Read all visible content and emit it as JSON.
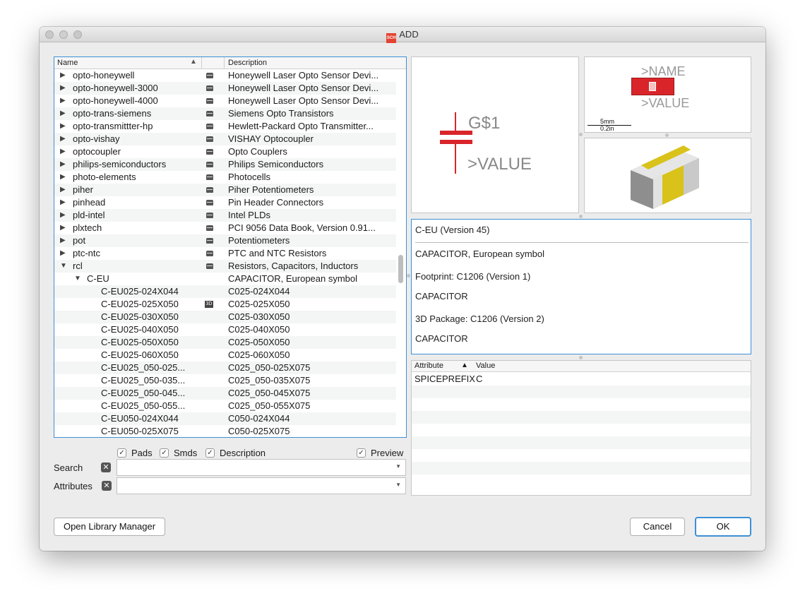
{
  "window": {
    "title": "ADD",
    "title_icon": "SCH"
  },
  "tree": {
    "columns": {
      "name": "Name",
      "description": "Description"
    },
    "rows": [
      {
        "name": "opto-honeywell",
        "desc": "Honeywell Laser Opto Sensor Devi...",
        "level": 0,
        "expanded": false,
        "icon": "lib"
      },
      {
        "name": "opto-honeywell-3000",
        "desc": "Honeywell Laser Opto Sensor Devi...",
        "level": 0,
        "expanded": false,
        "icon": "lib"
      },
      {
        "name": "opto-honeywell-4000",
        "desc": "Honeywell Laser Opto Sensor Devi...",
        "level": 0,
        "expanded": false,
        "icon": "lib"
      },
      {
        "name": "opto-trans-siemens",
        "desc": "Siemens Opto Transistors",
        "level": 0,
        "expanded": false,
        "icon": "lib"
      },
      {
        "name": "opto-transmittter-hp",
        "desc": "Hewlett-Packard Opto Transmitter...",
        "level": 0,
        "expanded": false,
        "icon": "lib"
      },
      {
        "name": "opto-vishay",
        "desc": "VISHAY Optocoupler",
        "level": 0,
        "expanded": false,
        "icon": "lib"
      },
      {
        "name": "optocoupler",
        "desc": "Opto Couplers",
        "level": 0,
        "expanded": false,
        "icon": "lib"
      },
      {
        "name": "philips-semiconductors",
        "desc": "Philips Semiconductors",
        "level": 0,
        "expanded": false,
        "icon": "lib"
      },
      {
        "name": "photo-elements",
        "desc": "Photocells",
        "level": 0,
        "expanded": false,
        "icon": "lib"
      },
      {
        "name": "piher",
        "desc": "Piher Potentiometers",
        "level": 0,
        "expanded": false,
        "icon": "lib"
      },
      {
        "name": "pinhead",
        "desc": "Pin Header Connectors",
        "level": 0,
        "expanded": false,
        "icon": "lib"
      },
      {
        "name": "pld-intel",
        "desc": "Intel PLDs",
        "level": 0,
        "expanded": false,
        "icon": "lib"
      },
      {
        "name": "plxtech",
        "desc": "PCI 9056 Data Book, Version 0.91...",
        "level": 0,
        "expanded": false,
        "icon": "lib"
      },
      {
        "name": "pot",
        "desc": "Potentiometers",
        "level": 0,
        "expanded": false,
        "icon": "lib"
      },
      {
        "name": "ptc-ntc",
        "desc": "PTC and NTC Resistors",
        "level": 0,
        "expanded": false,
        "icon": "lib"
      },
      {
        "name": "rcl",
        "desc": "Resistors, Capacitors, Inductors",
        "level": 0,
        "expanded": true,
        "icon": "lib"
      },
      {
        "name": "C-EU",
        "desc": "CAPACITOR, European symbol",
        "level": 1,
        "expanded": true,
        "icon": ""
      },
      {
        "name": "C-EU025-024X044",
        "desc": "C025-024X044",
        "level": 2,
        "icon": ""
      },
      {
        "name": "C-EU025-025X050",
        "desc": "C025-025X050",
        "level": 2,
        "icon": "3d"
      },
      {
        "name": "C-EU025-030X050",
        "desc": "C025-030X050",
        "level": 2,
        "icon": ""
      },
      {
        "name": "C-EU025-040X050",
        "desc": "C025-040X050",
        "level": 2,
        "icon": ""
      },
      {
        "name": "C-EU025-050X050",
        "desc": "C025-050X050",
        "level": 2,
        "icon": ""
      },
      {
        "name": "C-EU025-060X050",
        "desc": "C025-060X050",
        "level": 2,
        "icon": ""
      },
      {
        "name": "C-EU025_050-025...",
        "desc": "C025_050-025X075",
        "level": 2,
        "icon": ""
      },
      {
        "name": "C-EU025_050-035...",
        "desc": "C025_050-035X075",
        "level": 2,
        "icon": ""
      },
      {
        "name": "C-EU025_050-045...",
        "desc": "C025_050-045X075",
        "level": 2,
        "icon": ""
      },
      {
        "name": "C-EU025_050-055...",
        "desc": "C025_050-055X075",
        "level": 2,
        "icon": ""
      },
      {
        "name": "C-EU050-024X044",
        "desc": "C050-024X044",
        "level": 2,
        "icon": ""
      },
      {
        "name": "C-EU050-025X075",
        "desc": "C050-025X075",
        "level": 2,
        "icon": ""
      }
    ],
    "icon_3d_label": "3D"
  },
  "options": {
    "pads": "Pads",
    "smds": "Smds",
    "description": "Description",
    "preview": "Preview",
    "checked_mark": "✓"
  },
  "search": {
    "label": "Search",
    "value": ""
  },
  "attributes_filter": {
    "label": "Attributes",
    "value": ""
  },
  "symbol_preview": {
    "name": "G$1",
    "value": ">VALUE"
  },
  "package_preview": {
    "name": ">NAME",
    "value": ">VALUE",
    "scale_mm": "5mm",
    "scale_in": "0.2in"
  },
  "info": {
    "device": "C-EU (Version 45)",
    "device_desc": "CAPACITOR, European symbol",
    "footprint": "Footprint: C1206 (Version 1)",
    "footprint_desc": "CAPACITOR",
    "package3d": "3D Package: C1206 (Version 2)",
    "package3d_desc": "CAPACITOR"
  },
  "attributes": {
    "col_attribute": "Attribute",
    "col_value": "Value",
    "rows": [
      {
        "attribute": "SPICEPREFIX",
        "value": "C"
      }
    ]
  },
  "buttons": {
    "library_manager": "Open Library Manager",
    "cancel": "Cancel",
    "ok": "OK"
  },
  "colors": {
    "accent": "#3d8fd6",
    "symbol_red": "#d9252a",
    "chip_yellow": "#d9c21a"
  }
}
